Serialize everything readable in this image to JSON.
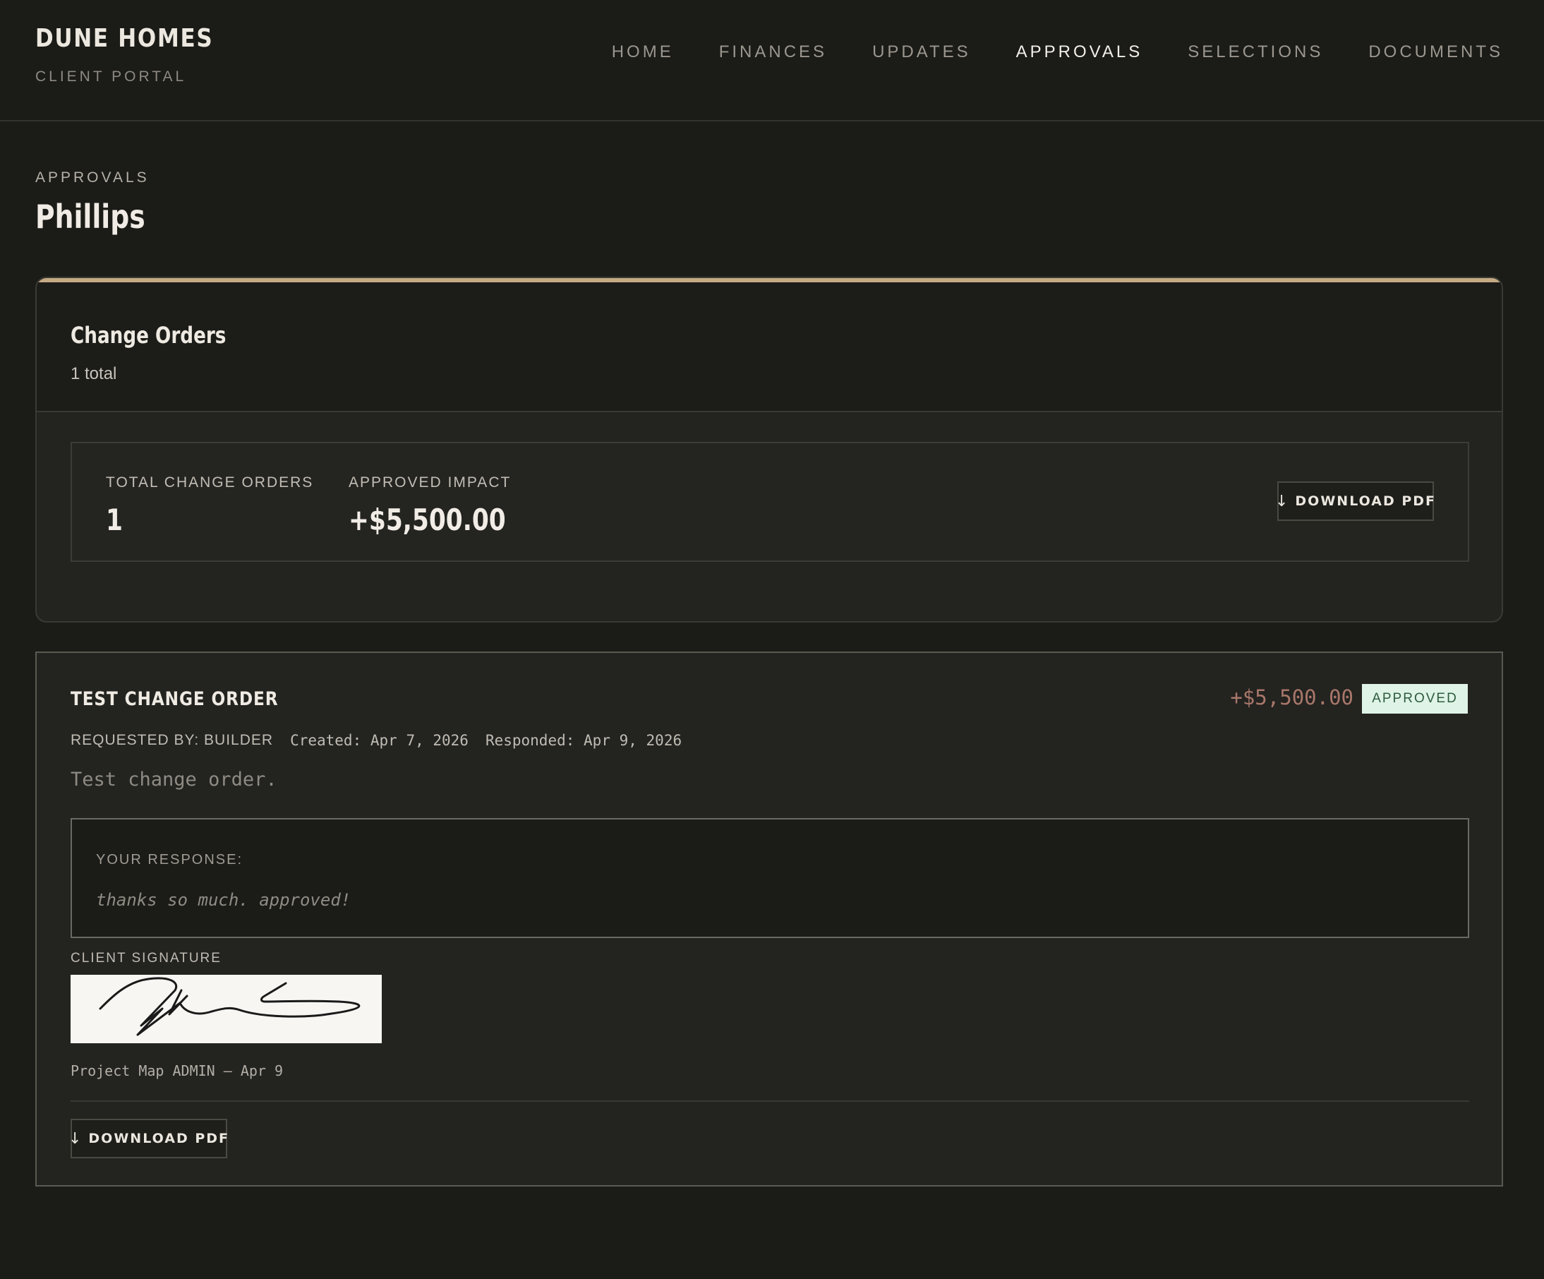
{
  "brand": {
    "name": "DUNE HOMES",
    "subtitle": "CLIENT PORTAL"
  },
  "nav": {
    "items": [
      {
        "label": "HOME",
        "active": false
      },
      {
        "label": "FINANCES",
        "active": false
      },
      {
        "label": "UPDATES",
        "active": false
      },
      {
        "label": "APPROVALS",
        "active": true
      },
      {
        "label": "SELECTIONS",
        "active": false
      },
      {
        "label": "DOCUMENTS",
        "active": false
      }
    ]
  },
  "page": {
    "eyebrow": "APPROVALS",
    "title": "Phillips"
  },
  "summary": {
    "title": "Change Orders",
    "count_text": "1 total",
    "total_label": "TOTAL CHANGE ORDERS",
    "total_value": "1",
    "impact_label": "APPROVED IMPACT",
    "impact_value": "+$5,500.00",
    "download_label": "DOWNLOAD PDF",
    "download_icon": "↓"
  },
  "order": {
    "title": "TEST CHANGE ORDER",
    "amount": "+$5,500.00",
    "status": "APPROVED",
    "requested_by": "REQUESTED BY: BUILDER",
    "created": "Created: Apr 7, 2026",
    "responded": "Responded: Apr 9, 2026",
    "description": "Test change order.",
    "response_label": "YOUR RESPONSE:",
    "response_text": "thanks so much. approved!",
    "signature_label": "CLIENT SIGNATURE",
    "signature_caption": "Project Map ADMIN — Apr 9",
    "download_label": "DOWNLOAD PDF",
    "download_icon": "↓"
  },
  "colors": {
    "background": "#1b1b17",
    "accent": "#c5a983",
    "amount": "#a8776a",
    "approved_badge_bg": "#dff3e6",
    "approved_badge_text": "#2e5c3e"
  }
}
